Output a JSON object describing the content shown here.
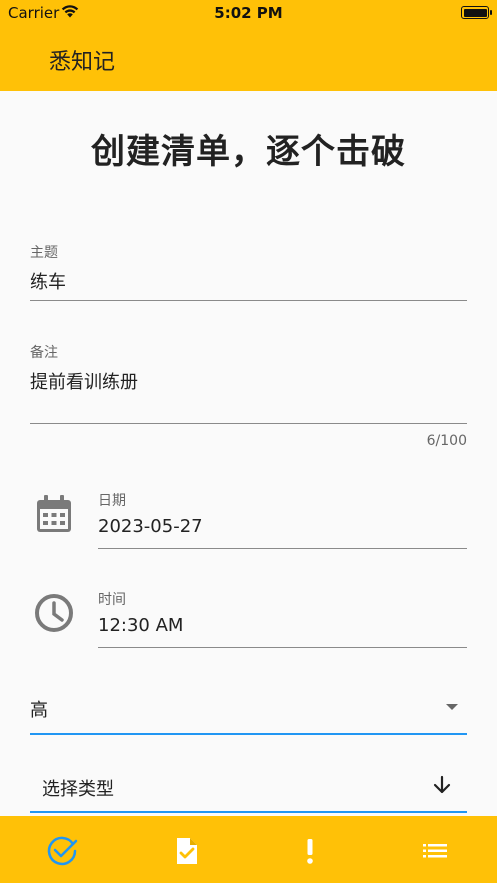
{
  "status_bar": {
    "carrier": "Carrier",
    "time": "5:02 PM"
  },
  "app_bar": {
    "title": "悉知记"
  },
  "page": {
    "heading": "创建清单，逐个击破"
  },
  "form": {
    "subject": {
      "label": "主题",
      "value": "练车"
    },
    "note": {
      "label": "备注",
      "value": "提前看训练册",
      "counter": "6/100"
    },
    "date": {
      "label": "日期",
      "value": "2023-05-27"
    },
    "time": {
      "label": "时间",
      "value": "12:30 AM"
    },
    "priority": {
      "value": "高"
    },
    "type": {
      "placeholder": "选择类型"
    }
  },
  "bottom_nav": {
    "items": [
      {
        "icon": "check-circle-icon",
        "active": true
      },
      {
        "icon": "document-check-icon",
        "active": false
      },
      {
        "icon": "exclamation-icon",
        "active": false
      },
      {
        "icon": "list-icon",
        "active": false
      }
    ]
  },
  "colors": {
    "primary": "#ffc107",
    "accent": "#2196f3",
    "active_icon": "#2196f3",
    "inactive_icon": "#ffffff"
  }
}
